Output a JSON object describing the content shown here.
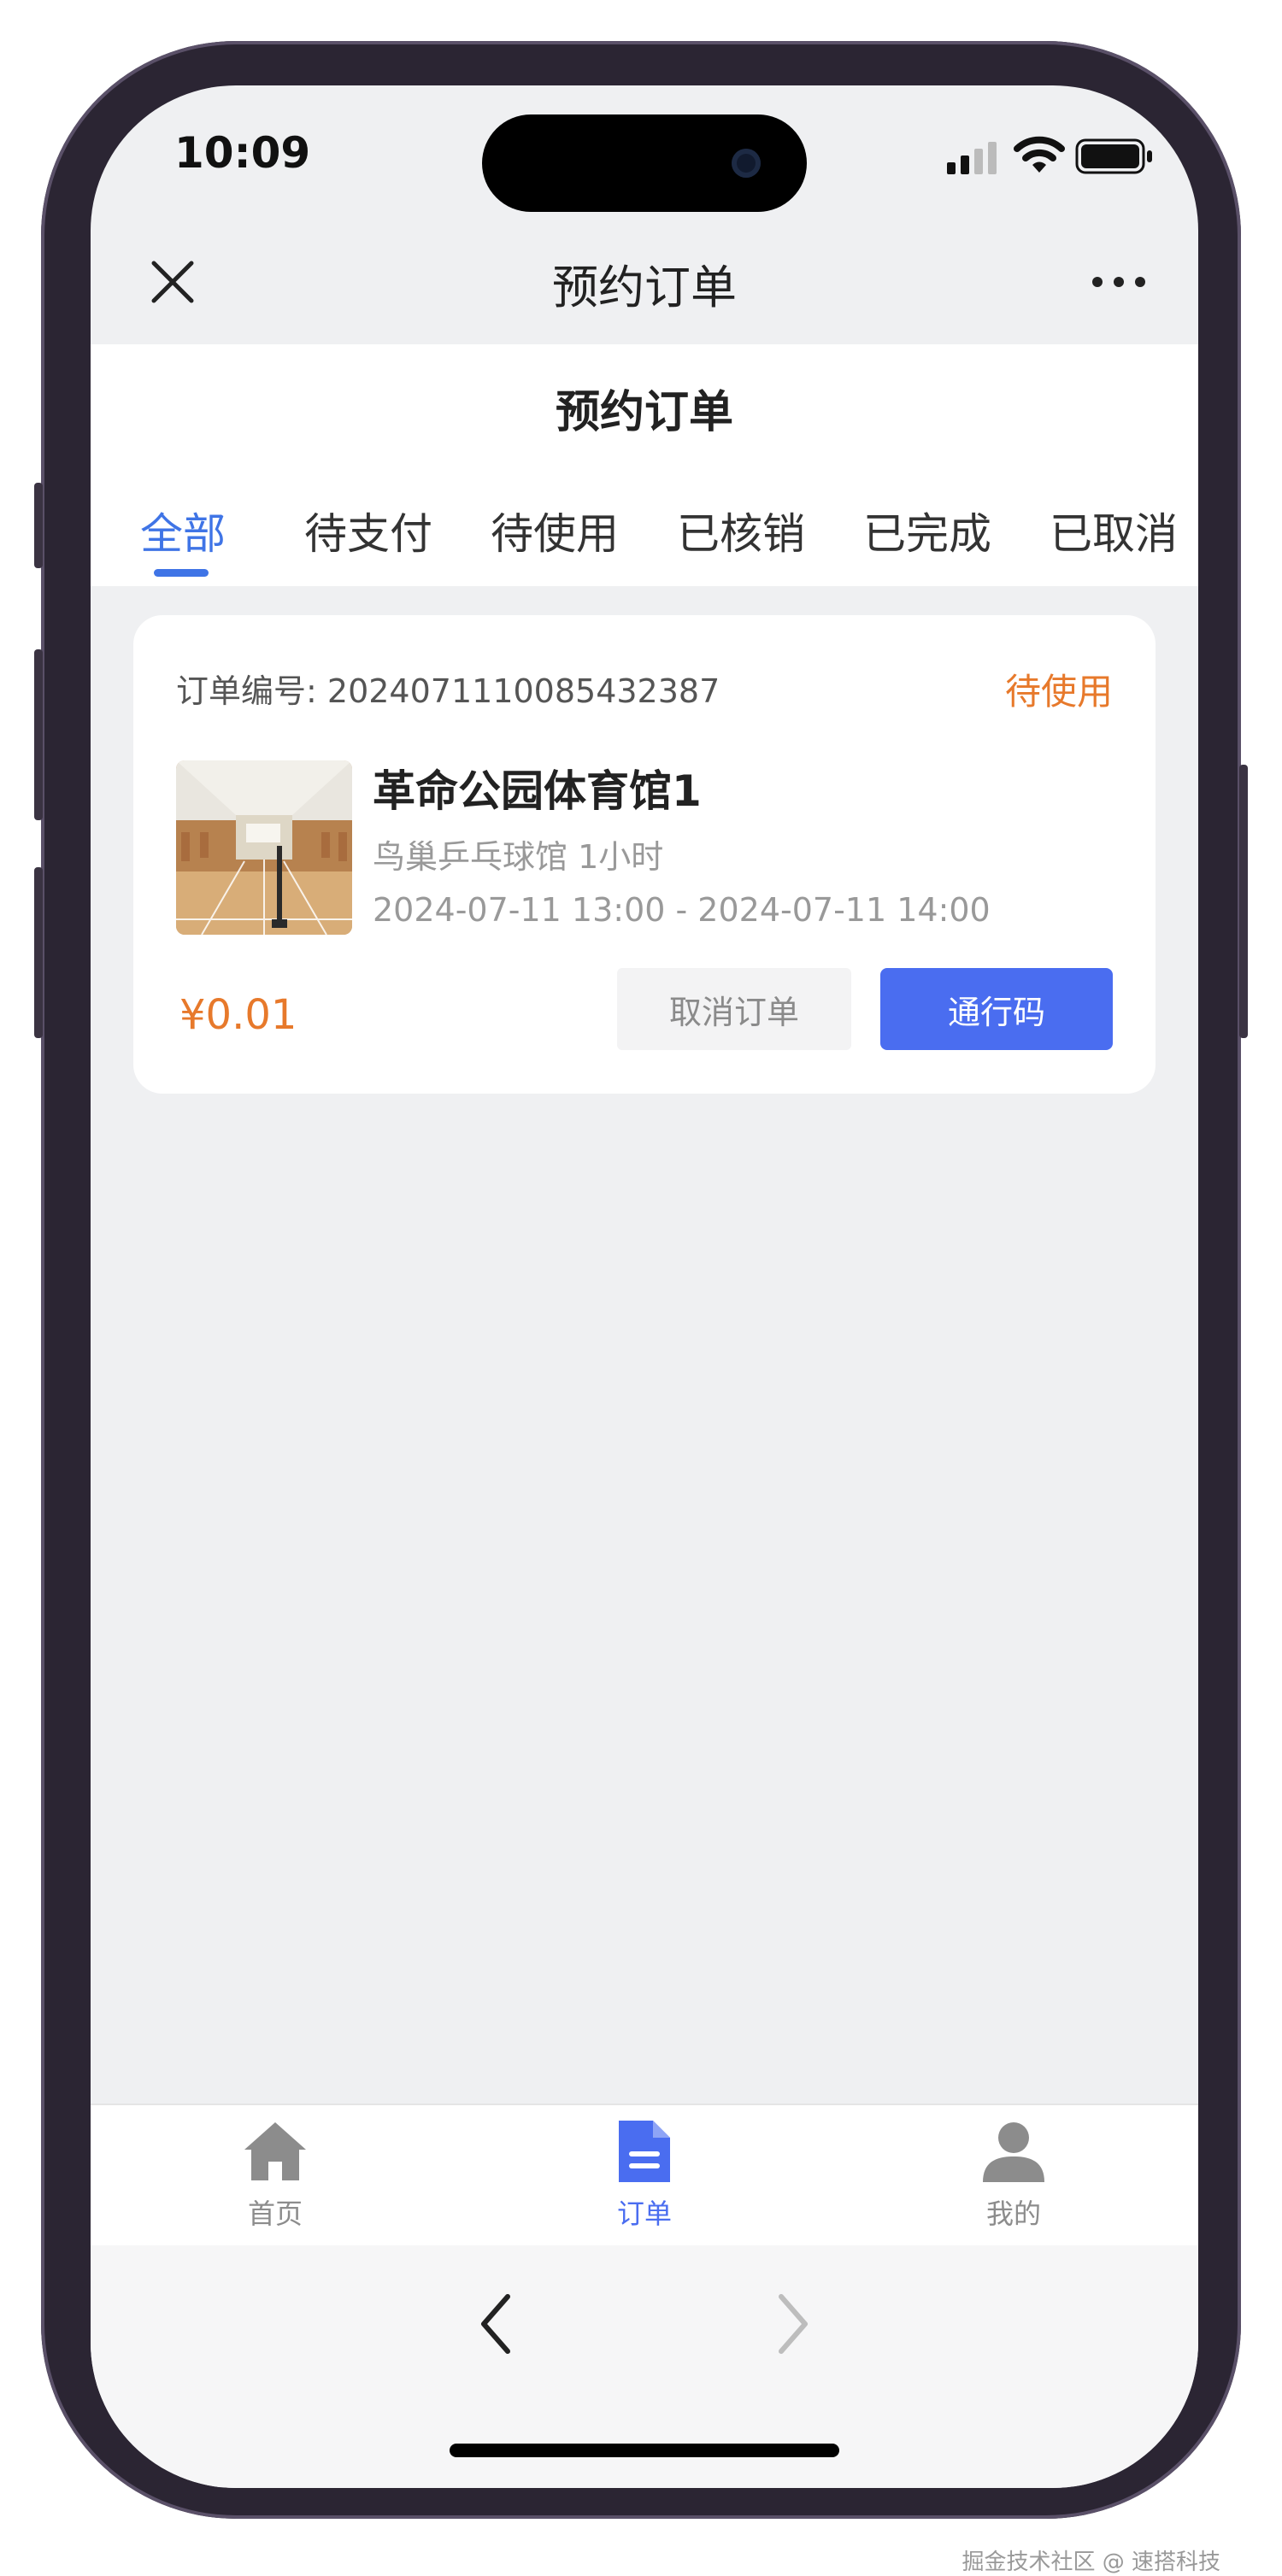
{
  "status_bar": {
    "time": "10:09"
  },
  "nav_bar": {
    "title": "预约订单"
  },
  "page": {
    "title": "预约订单"
  },
  "tabs": [
    {
      "label": "全部",
      "active": true
    },
    {
      "label": "待支付"
    },
    {
      "label": "待使用"
    },
    {
      "label": "已核销"
    },
    {
      "label": "已完成"
    },
    {
      "label": "已取消"
    }
  ],
  "order": {
    "number_label": "订单编号:",
    "number": "2024071110085432387",
    "status": "待使用",
    "title": "革命公园体育馆1",
    "subtitle": "鸟巢乒乓球馆 1小时",
    "time_range": "2024-07-11 13:00 - 2024-07-11 14:00",
    "price": "¥0.01",
    "cancel_label": "取消订单",
    "pass_label": "通行码"
  },
  "tabbar": [
    {
      "label": "首页",
      "icon": "home-icon",
      "active": false
    },
    {
      "label": "订单",
      "icon": "order-icon",
      "active": true
    },
    {
      "label": "我的",
      "icon": "user-icon",
      "active": false
    }
  ],
  "watermark": "掘金技术社区 @ 速搭科技",
  "colors": {
    "accent": "#3f74e6",
    "orange": "#e7792b",
    "button": "#4a6df0"
  }
}
